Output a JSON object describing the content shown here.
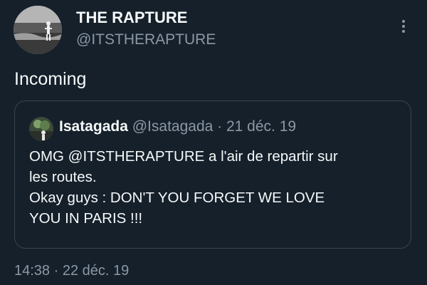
{
  "tweet": {
    "author": {
      "name": "THE RAPTURE",
      "handle": "@ITSTHERAPTURE"
    },
    "text": "Incoming",
    "time": "14:38",
    "separator": "·",
    "date": "22 déc. 19"
  },
  "quoted_tweet": {
    "author_name": "Isatagada",
    "handle": "@Isatagada",
    "separator": "·",
    "date": "21 déc. 19",
    "lines": [
      "OMG @ITSTHERAPTURE a l'air de repartir sur",
      "les routes.",
      "Okay guys : DON'T YOU FORGET WE LOVE",
      "YOU IN PARIS !!!"
    ]
  },
  "icons": {
    "more": "more-options-icon"
  },
  "colors": {
    "background": "#15202b",
    "primary_text": "#f7f9f9",
    "secondary_text": "#8b98a5",
    "border": "#38444d"
  }
}
